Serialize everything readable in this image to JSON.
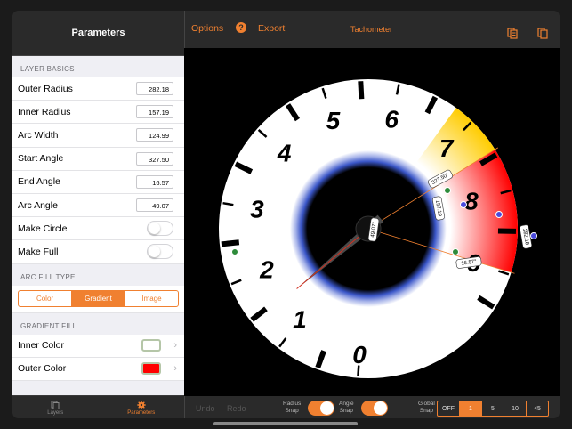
{
  "left": {
    "header_title": "Parameters",
    "layer_basics": {
      "section_title": "LAYER BASICS",
      "rows": [
        {
          "label": "Outer Radius",
          "value": "282.18"
        },
        {
          "label": "Inner Radius",
          "value": "157.19"
        },
        {
          "label": "Arc Width",
          "value": "124.99"
        },
        {
          "label": "Start Angle",
          "value": "327.50"
        },
        {
          "label": "End Angle",
          "value": "16.57"
        },
        {
          "label": "Arc Angle",
          "value": "49.07"
        }
      ],
      "toggles": [
        {
          "label": "Make Circle",
          "on": false
        },
        {
          "label": "Make Full",
          "on": false
        }
      ]
    },
    "arc_fill": {
      "section_title": "ARC FILL TYPE",
      "options": [
        "Color",
        "Gradient",
        "Image"
      ],
      "selected": "Gradient"
    },
    "gradient_fill": {
      "section_title": "GRADIENT FILL",
      "inner_color_label": "Inner Color",
      "inner_color": "#ffffff",
      "outer_color_label": "Outer Color",
      "outer_color": "#ff0000"
    },
    "tabs": [
      {
        "label": "Layers",
        "icon": "layers-icon"
      },
      {
        "label": "Parameters",
        "icon": "gear-icon",
        "active": true
      }
    ]
  },
  "topbar": {
    "options": "Options",
    "export": "Export",
    "title": "Tachometer",
    "help_icon": "?"
  },
  "gauge": {
    "numbers": [
      "0",
      "1",
      "2",
      "3",
      "4",
      "5",
      "6",
      "7",
      "8",
      "9"
    ],
    "handle_labels": {
      "start": "327.50°",
      "end": "16.57°",
      "center": "49.07°",
      "inner": "157.19",
      "outer": "282.18"
    },
    "accent": "#f08030"
  },
  "bottombar": {
    "undo": "Undo",
    "redo": "Redo",
    "radius_snap_line1": "Radius",
    "radius_snap_line2": "Snap",
    "angle_snap_line1": "Angle",
    "angle_snap_line2": "Snap",
    "global_snap_line1": "Global",
    "global_snap_line2": "Snap",
    "global_snap_options": [
      "OFF",
      "1",
      "5",
      "10",
      "45"
    ],
    "global_snap_selected": "1"
  }
}
